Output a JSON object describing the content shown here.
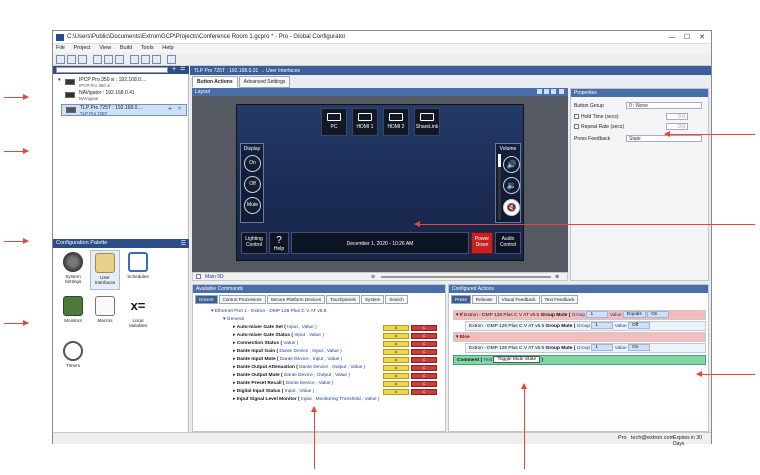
{
  "window": {
    "title": "C:\\Users\\Public\\Documents\\Extron\\GCP\\Projects\\Conference Room 1.gcpro * - Pro - Global Configurator",
    "minimize": "—",
    "maximize": "☐",
    "close": "✕"
  },
  "menu": [
    "File",
    "Project",
    "View",
    "Build",
    "Tools",
    "Help"
  ],
  "tree": {
    "items": [
      {
        "name": "IPCP Pro 350 xi : 192.168.0....",
        "sub": "IPCP Pro 350 xi"
      },
      {
        "name": "NAVigator : 192.168.0.41",
        "sub": "NAVigator"
      },
      {
        "name": "TLP Pro 725T : 192.168.0....",
        "sub": "TLP Pro 725T"
      }
    ]
  },
  "palette": {
    "title": "Configuration Palette",
    "items": [
      {
        "label": "System Settings",
        "color": "#444"
      },
      {
        "label": "User Interfaces",
        "color": "#c9a85a"
      },
      {
        "label": "Schedules",
        "color": "#3a6db5"
      },
      {
        "label": "Monitors",
        "color": "#4d7a3a"
      },
      {
        "label": "Macros",
        "color": "#777"
      },
      {
        "label": "Local Variables",
        "color": "#111"
      },
      {
        "label": "Timers",
        "color": "#555"
      }
    ]
  },
  "breadcrumb": "TLP Pro 725T : 192.168.0.31 → User Interfaces",
  "tabs": {
    "button_actions": "Button Actions",
    "advanced_settings": "Advanced Settings"
  },
  "layout": {
    "header": "Layout",
    "sources": [
      "PC",
      "HDMI 1",
      "HDMI 2",
      "ShareLink"
    ],
    "display": {
      "title": "Display",
      "buttons": [
        "On",
        "Off",
        "Mute"
      ]
    },
    "volume": {
      "title": "Volume"
    },
    "bottom": {
      "lighting": "Lighting Control",
      "help": "Help",
      "datetime": "December 1, 2020 - 10:26 AM",
      "power": "Power Down",
      "audio": "Audio Control"
    },
    "footer_page": "Main 5D"
  },
  "properties": {
    "header": "Properties",
    "button_group_label": "Button Group",
    "button_group_value": "0 : None",
    "hold_time_label": "Hold Time (secs)",
    "hold_time_value": "0.0",
    "repeat_rate_label": "Repeat Rate (secs)",
    "repeat_rate_value": "0.0",
    "press_feedback_label": "Press Feedback",
    "press_feedback_value": "State"
  },
  "available": {
    "header": "Available Commands",
    "tabs": [
      "Drivers",
      "Control Processors",
      "Secure Platform Devices",
      "Touchpanels",
      "System",
      "Search"
    ],
    "port": "Ethernet Port 1 - Extron - DMP 128 Plus C V AT v6.5",
    "general": "General",
    "commands": [
      {
        "name": "Auto-mixer Gate Set (",
        "params": "Input ,  Value )"
      },
      {
        "name": "Auto-mixer Gate Status (",
        "params": "Input ,  Value )"
      },
      {
        "name": "Connection Status (",
        "params": "Value )"
      },
      {
        "name": "Dante Input Gain (",
        "params": "Dante Device ,  Input ,  Value )"
      },
      {
        "name": "Dante Input Mute (",
        "params": "Dante Device ,  Input ,  Value )"
      },
      {
        "name": "Dante Output Attenuation (",
        "params": "Dante Device ,  Output ,  Value )"
      },
      {
        "name": "Dante Output Mute (",
        "params": "Dante Device ,  Output ,  Value )"
      },
      {
        "name": "Dante Preset Recall (",
        "params": "Dante Device ,  Value )"
      },
      {
        "name": "Digital Input Status (",
        "params": "Input ,  Value )"
      },
      {
        "name": "Input Signal Level Monitor (",
        "params": "Input ,  Monitoring Threshold ,  Value )"
      }
    ],
    "tag_a": "A",
    "tag_c": "C"
  },
  "configured": {
    "header": "Configured Actions",
    "tabs": [
      "Press",
      "Release",
      "Visual Feedback",
      "Text Feedback"
    ],
    "if_row": {
      "prefix": "If",
      "device": "Extron - DMP 128 Plus C V AT v6.5",
      "cmd": "Group Mute (",
      "group": "Group",
      "g1": "1",
      "value": "Value",
      "op": "Equals",
      "val2": "On"
    },
    "action_row": {
      "device": "Extron - DMP 128 Plus C V AT v6.5",
      "cmd": "Group Mute (",
      "group": "Group",
      "g1": "1",
      "value": "Value",
      "val2": "Off"
    },
    "else_row": "Else",
    "action_row2": {
      "device": "Extron - DMP 128 Plus C V AT v6.5",
      "cmd": "Group Mute (",
      "group": "Group",
      "g1": "1",
      "value": "Value",
      "val2": "On"
    },
    "comment": {
      "label": "Comment (",
      "text_label": "Text",
      "text_value": "Toggle Mute State",
      "close": ")"
    }
  },
  "status": {
    "mode": "Pro",
    "email": "tech@extron.com",
    "expires": "Expires in 30 Days"
  }
}
